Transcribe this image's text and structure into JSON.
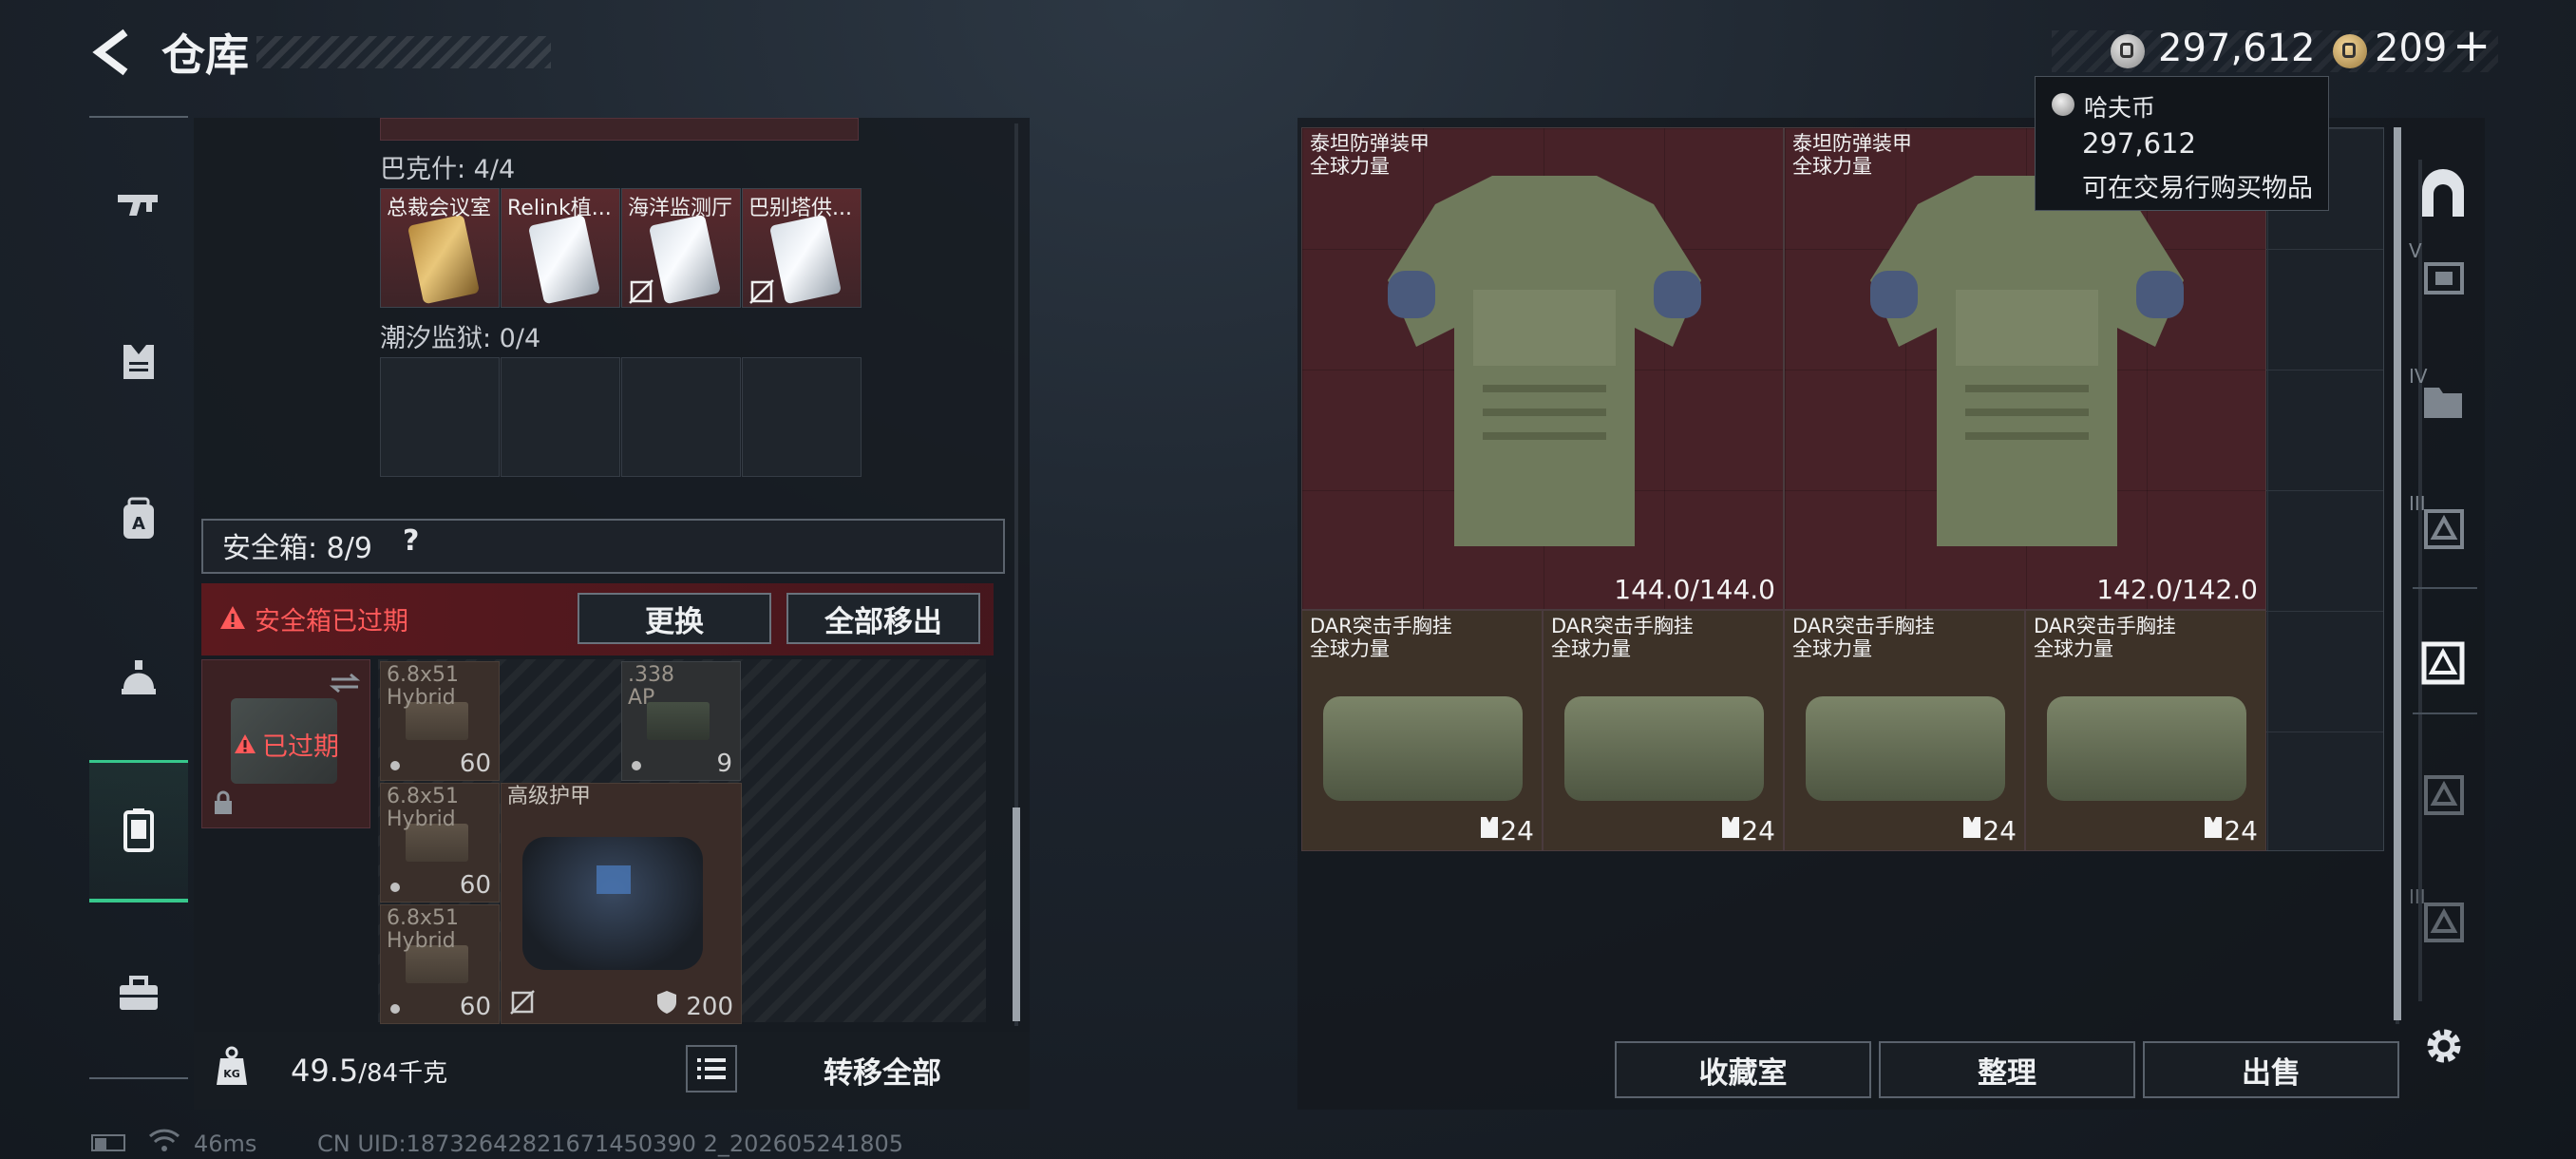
{
  "header": {
    "title": "仓库"
  },
  "currency": {
    "haf_value": "297,612",
    "gold_value": "209",
    "plus": "+"
  },
  "tooltip": {
    "name": "哈夫币",
    "value": "297,612",
    "description": "可在交易行购买物品"
  },
  "left_nav": {
    "items": [
      {
        "icon": "rifle-icon"
      },
      {
        "icon": "armor-vest-icon"
      },
      {
        "icon": "backpack-a-icon"
      },
      {
        "icon": "helmet-bag-icon"
      },
      {
        "icon": "safebox-icon",
        "active": true
      },
      {
        "icon": "toolbox-icon"
      }
    ]
  },
  "keycards": {
    "group1_label": "巴克什: 4/4",
    "cards": [
      {
        "label": "总裁会议室",
        "type": "gold"
      },
      {
        "label": "Relink植...",
        "type": "silver"
      },
      {
        "label": "海洋监测厅",
        "type": "silver"
      },
      {
        "label": "巴别塔供...",
        "type": "silver"
      }
    ],
    "group2_label": "潮汐监狱: 0/4"
  },
  "safebox": {
    "label": "安全箱: 8/9",
    "help": "?",
    "expired_notice": "安全箱已过期",
    "replace_label": "更换",
    "move_all_out_label": "全部移出",
    "card_expired_text": "已过期",
    "items": [
      {
        "name": "6.8x51",
        "sub": "Hybrid",
        "count": "60"
      },
      {
        "name": ".338",
        "sub": "AP",
        "count": "9"
      },
      {
        "name": "6.8x51",
        "sub": "Hybrid",
        "count": "60"
      },
      {
        "name": "6.8x51",
        "sub": "Hybrid",
        "count": "60"
      }
    ],
    "armor_label": "高级护甲",
    "armor_durability": "200"
  },
  "inventory_bar": {
    "weight_current": "49.5",
    "weight_max": "/84千克",
    "transfer_all_label": "转移全部"
  },
  "storage": {
    "armors": [
      {
        "name": "泰坦防弹装甲",
        "sub": "全球力量",
        "durability": "144.0/144.0"
      },
      {
        "name": "泰坦防弹装甲",
        "sub": "全球力量",
        "durability": "142.0/142.0"
      }
    ],
    "rigs": [
      {
        "name": "DAR突击手胸挂",
        "sub": "全球力量",
        "slots": "24"
      },
      {
        "name": "DAR突击手胸挂",
        "sub": "全球力量",
        "slots": "24"
      },
      {
        "name": "DAR突击手胸挂",
        "sub": "全球力量",
        "slots": "24"
      },
      {
        "name": "DAR突击手胸挂",
        "sub": "全球力量",
        "slots": "24"
      }
    ]
  },
  "right_nav": {
    "labels": [
      "V",
      "IV",
      "III",
      "",
      "",
      "III"
    ]
  },
  "bottom_buttons": {
    "collection": "收藏室",
    "sort": "整理",
    "sell": "出售"
  },
  "status": {
    "ping": "46ms",
    "uid": "CN UID:18732642821671450390 2_202605241805"
  }
}
